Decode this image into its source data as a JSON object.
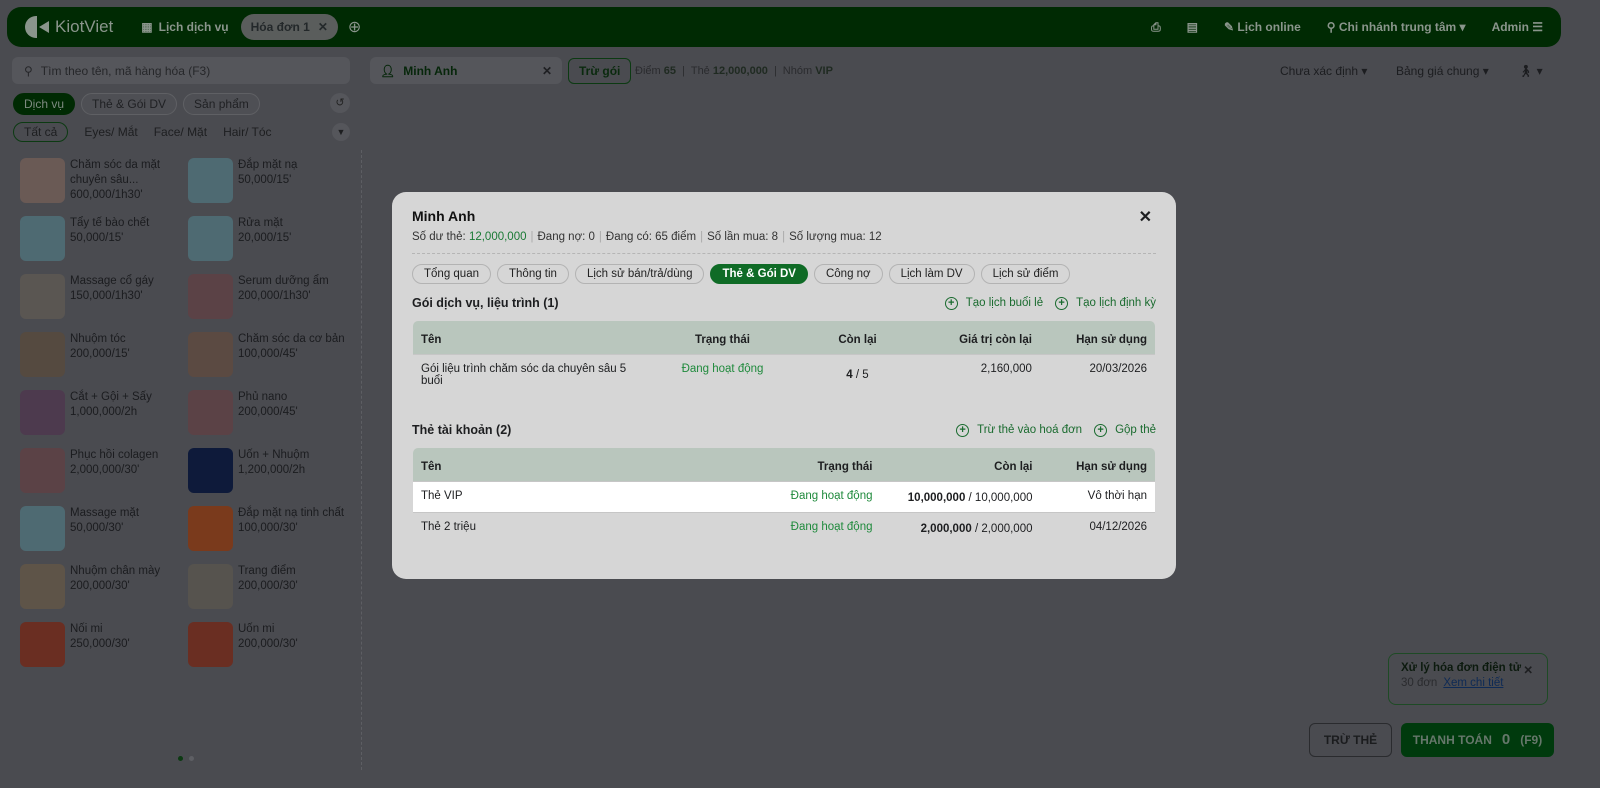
{
  "header": {
    "brand": "KiotViet",
    "nav_schedule": "Lịch dịch vụ",
    "tab_invoice": "Hóa đơn 1",
    "online": "Lịch online",
    "branch": "Chi nhánh trung tâm",
    "user": "Admin"
  },
  "left": {
    "search_placeholder": "Tìm theo tên, mã hàng hóa (F3)",
    "categories": [
      "Dịch vụ",
      "Thẻ & Gói DV",
      "Sản phẩm"
    ],
    "filters": [
      "Tất cả",
      "Eyes/ Mắt",
      "Face/ Mặt",
      "Hair/ Tóc"
    ],
    "products": [
      {
        "name": "Chăm sóc da mặt chuyên sâu...",
        "price": "600,000/1h30'",
        "color": "#6a5a55"
      },
      {
        "name": "Đắp mặt nạ",
        "price": "50,000/15'",
        "color": "#4e6a72"
      },
      {
        "name": "Tẩy tế bào chết",
        "price": "50,000/15'",
        "color": "#4e6a72"
      },
      {
        "name": "Rửa mặt",
        "price": "20,000/15'",
        "color": "#4e6a72"
      },
      {
        "name": "Massage cổ gáy",
        "price": "150,000/1h30'",
        "color": "#5a5652"
      },
      {
        "name": "Serum dưỡng ẩm",
        "price": "200,000/1h30'",
        "color": "#5b4246"
      },
      {
        "name": "Nhuộm tóc",
        "price": "200,000/15'",
        "color": "#554a40"
      },
      {
        "name": "Chăm sóc da cơ bản",
        "price": "100,000/45'",
        "color": "#5b4a42"
      },
      {
        "name": "Cắt + Gội + Sấy",
        "price": "1,000,000/2h",
        "color": "#4d3a4e"
      },
      {
        "name": "Phủ nano",
        "price": "200,000/45'",
        "color": "#5b4246"
      },
      {
        "name": "Phục hồi colagen",
        "price": "2,000,000/30'",
        "color": "#5b4246"
      },
      {
        "name": "Uốn + Nhuộm",
        "price": "1,200,000/2h",
        "color": "#0e1a3a"
      },
      {
        "name": "Massage mặt",
        "price": "50,000/30'",
        "color": "#4e6a72"
      },
      {
        "name": "Đắp mặt nạ tinh chất",
        "price": "100,000/30'",
        "color": "#7a3a1c"
      },
      {
        "name": "Nhuộm chân mày",
        "price": "200,000/30'",
        "color": "#5e5448"
      },
      {
        "name": "Trang điểm",
        "price": "200,000/30'",
        "color": "#56534e"
      },
      {
        "name": "Nối mi",
        "price": "250,000/30'",
        "color": "#6a2e22"
      },
      {
        "name": "Uốn mi",
        "price": "200,000/30'",
        "color": "#6a2e22"
      }
    ]
  },
  "customer": {
    "name": "Minh Anh",
    "deduct_package": "Trừ gói",
    "points_label": "Điểm",
    "points": "65",
    "card_label": "Thẻ",
    "card": "12,000,000",
    "group_label": "Nhóm",
    "group": "VIP"
  },
  "right_dropdowns": {
    "status": "Chưa xác định",
    "pricebook": "Bảng giá chung"
  },
  "modal": {
    "title": "Minh Anh",
    "summary": [
      {
        "label": "Số dư thẻ: ",
        "value": "12,000,000"
      },
      {
        "label": "Đang nợ: ",
        "value": "0"
      },
      {
        "label": "Đang có: ",
        "value": "65 điểm"
      },
      {
        "label": "Số lần mua: ",
        "value": "8"
      },
      {
        "label": "Số lượng mua: ",
        "value": "12"
      }
    ],
    "tabs": [
      "Tổng quan",
      "Thông tin",
      "Lịch sử bán/trả/dùng",
      "Thẻ & Gói DV",
      "Công nợ",
      "Lịch làm DV",
      "Lịch sử điểm"
    ],
    "packages": {
      "title": "Gói dịch vụ, liệu trình (1)",
      "action1": "Tạo lịch buổi lẻ",
      "action2": "Tạo lịch định kỳ",
      "headers": [
        "Tên",
        "Trạng thái",
        "Còn lại",
        "Giá trị còn lại",
        "Hạn sử dụng"
      ],
      "rows": [
        {
          "name": "Gói liệu trình chăm sóc da chuyên sâu 5 buổi",
          "status": "Đang hoạt động",
          "remain": "4",
          "total": " / 5",
          "value": "2,160,000",
          "expiry": "20/03/2026"
        }
      ]
    },
    "cards": {
      "title": "Thẻ tài khoản (2)",
      "action1": "Trừ thẻ vào hoá đơn",
      "action2": "Gộp thẻ",
      "headers": [
        "Tên",
        "Trạng thái",
        "Còn lại",
        "Hạn sử dụng"
      ],
      "rows": [
        {
          "name": "Thẻ VIP",
          "status": "Đang hoạt động",
          "remain": "10,000,000",
          "total": " / 10,000,000",
          "expiry": "Vô thời hạn"
        },
        {
          "name": "Thẻ 2 triệu",
          "status": "Đang hoạt động",
          "remain": "2,000,000",
          "total": " / 2,000,000",
          "expiry": "04/12/2026"
        }
      ]
    }
  },
  "toast": {
    "title": "Xử lý hóa đơn điện tử",
    "count": "30 đơn",
    "link": "Xem chi tiết"
  },
  "footer": {
    "deduct_card": "TRỪ THẺ",
    "pay": "THANH TOÁN",
    "pay_amount": "0",
    "pay_key": "(F9)"
  }
}
